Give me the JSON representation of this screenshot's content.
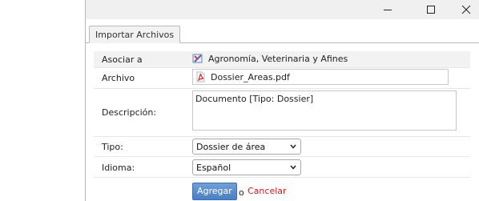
{
  "window": {
    "controls": {
      "minimize_icon": "minimize-icon",
      "maximize_icon": "maximize-icon",
      "close_icon": "close-icon"
    }
  },
  "tabs": [
    {
      "label": "Importar Archivos",
      "active": true
    }
  ],
  "form": {
    "asociar": {
      "label": "Asociar a",
      "icon": "category-icon",
      "value": "Agronomía, Veterinaria y Afines"
    },
    "archivo": {
      "label": "Archivo",
      "icon": "pdf-file-icon",
      "value": "Dossier_Areas.pdf"
    },
    "descripcion": {
      "label": "Descripción:",
      "value": "Documento [Tipo: Dossier]"
    },
    "tipo": {
      "label": "Tipo:",
      "selected": "Dossier de área"
    },
    "idioma": {
      "label": "Idioma:",
      "selected": "Español"
    },
    "actions": {
      "submit_label": "Agregar",
      "separator": "o",
      "cancel_label": "Cancelar"
    }
  },
  "colors": {
    "accent_button": "#4a7fc4",
    "cancel_link": "#cc2222",
    "row_highlight": "#f2f2f2"
  }
}
